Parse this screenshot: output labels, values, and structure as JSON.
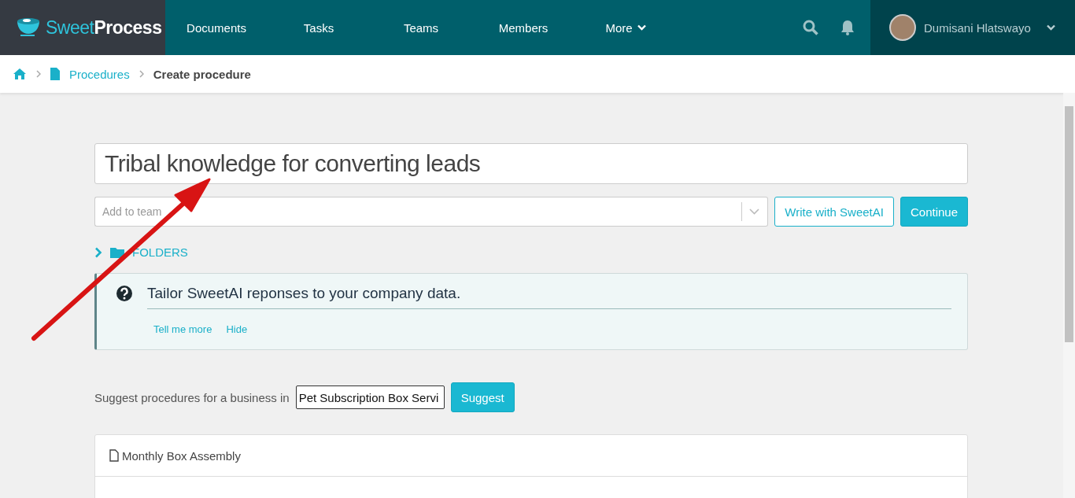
{
  "logo": {
    "part_1": "Sweet",
    "part_2": "Process"
  },
  "nav": {
    "items": [
      {
        "label": "Documents",
        "kind": "link"
      },
      {
        "label": "Tasks",
        "kind": "link"
      },
      {
        "label": "Teams",
        "kind": "link"
      },
      {
        "label": "Members",
        "kind": "link"
      },
      {
        "label": "More",
        "kind": "dropdown"
      }
    ],
    "user": {
      "name": "Dumisani Hlatswayo"
    }
  },
  "breadcrumb": [
    {
      "label": "Procedures",
      "kind": "link"
    },
    {
      "label": "Create procedure",
      "kind": "current"
    }
  ],
  "title_field": {
    "value": "Tribal knowledge for converting leads"
  },
  "team_select": {
    "placeholder": "Add to team"
  },
  "buttons": [
    {
      "label": "Write with SweetAI",
      "kind": "outline"
    },
    {
      "label": "Continue",
      "kind": "primary"
    }
  ],
  "folders": {
    "label": "FOLDERS",
    "expanded": false
  },
  "tip": {
    "text": "Tailor SweetAI reponses to your company data.",
    "links": [
      "Tell me more",
      "Hide"
    ]
  },
  "suggest": {
    "label": "Suggest procedures for a business in",
    "value": "Pet Subscription Box Servi",
    "button": "Suggest"
  },
  "suggestions": [
    {
      "title": "Monthly Box Assembly"
    }
  ]
}
